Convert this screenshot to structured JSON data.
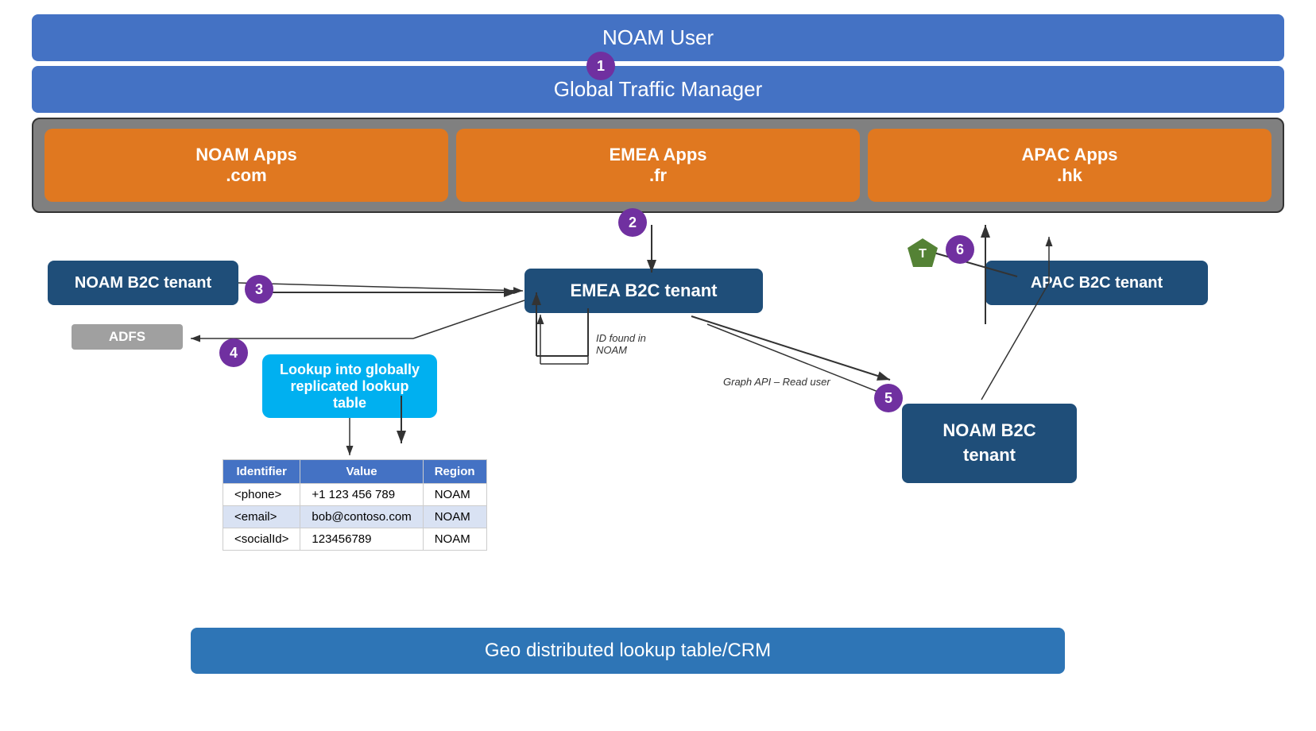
{
  "noam_user": "NOAM User",
  "gtm": "Global Traffic Manager",
  "apps": [
    {
      "name": "NOAM Apps\n.com"
    },
    {
      "name": "EMEA Apps\n.fr"
    },
    {
      "name": "APAC Apps\n.hk"
    }
  ],
  "badges": [
    "1",
    "2",
    "3",
    "4",
    "5",
    "6"
  ],
  "tenants": {
    "noam": "NOAM B2C tenant",
    "emea": "EMEA B2C tenant",
    "apac": "APAC B2C tenant",
    "noam2": "NOAM B2C\ntenant"
  },
  "adfs": "ADFS",
  "lookup_box": "Lookup into globally\nreplicated lookup table",
  "table": {
    "headers": [
      "Identifier",
      "Value",
      "Region"
    ],
    "rows": [
      [
        "<phone>",
        "+1 123 456 789",
        "NOAM"
      ],
      [
        "<email>",
        "bob@contoso.com",
        "NOAM"
      ],
      [
        "<socialId>",
        "123456789",
        "NOAM"
      ]
    ]
  },
  "geo_bar": "Geo distributed lookup table/CRM",
  "labels": {
    "id_found": "ID found in\nNOAM",
    "graph_api": "Graph API – Read user"
  },
  "colors": {
    "blue_dark": "#1F4E79",
    "blue_mid": "#2E75B6",
    "blue_light": "#4472C4",
    "orange": "#E07820",
    "purple": "#7030A0",
    "cyan": "#00B0F0",
    "green": "#548235",
    "gray": "#808080"
  }
}
